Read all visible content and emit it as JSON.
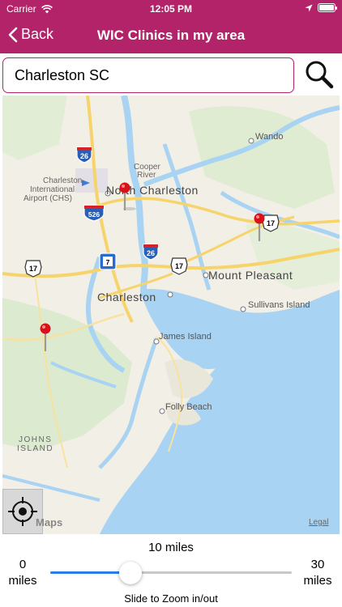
{
  "status_bar": {
    "carrier": "Carrier",
    "time": "12:05 PM"
  },
  "nav": {
    "back_label": "Back",
    "title": "WIC Clinics in my area"
  },
  "search": {
    "value": "Charleston SC",
    "icon": "magnifier-icon"
  },
  "map": {
    "labels": {
      "wando": "Wando",
      "airport": "Charleston\nInternational\nAirport (CHS)",
      "cooper_river": "Cooper\nRiver",
      "north_charleston": "North Charleston",
      "mount_pleasant": "Mount Pleasant",
      "charleston": "Charleston",
      "sullivans_island": "Sullivans Island",
      "james_island": "James Island",
      "folly_beach": "Folly Beach",
      "johns_island": "JOHNS\nISLAND"
    },
    "shields": {
      "i26_north": "26",
      "i526": "526",
      "i26_south": "26",
      "us17_west": "17",
      "us17_center": "17",
      "us17_east": "17",
      "sc7": "7"
    },
    "attribution": "Maps",
    "legal": "Legal",
    "colors": {
      "water": "#a9d3f2",
      "land": "#f2efe6",
      "green": "#d3e8c4",
      "road": "#f6d46b",
      "pin": "#d9121a"
    }
  },
  "slider": {
    "current_label": "10 miles",
    "min_value": "0",
    "min_unit": "miles",
    "max_value": "30",
    "max_unit": "miles",
    "min": 0,
    "max": 30,
    "value": 10,
    "hint": "Slide to Zoom in/out"
  }
}
